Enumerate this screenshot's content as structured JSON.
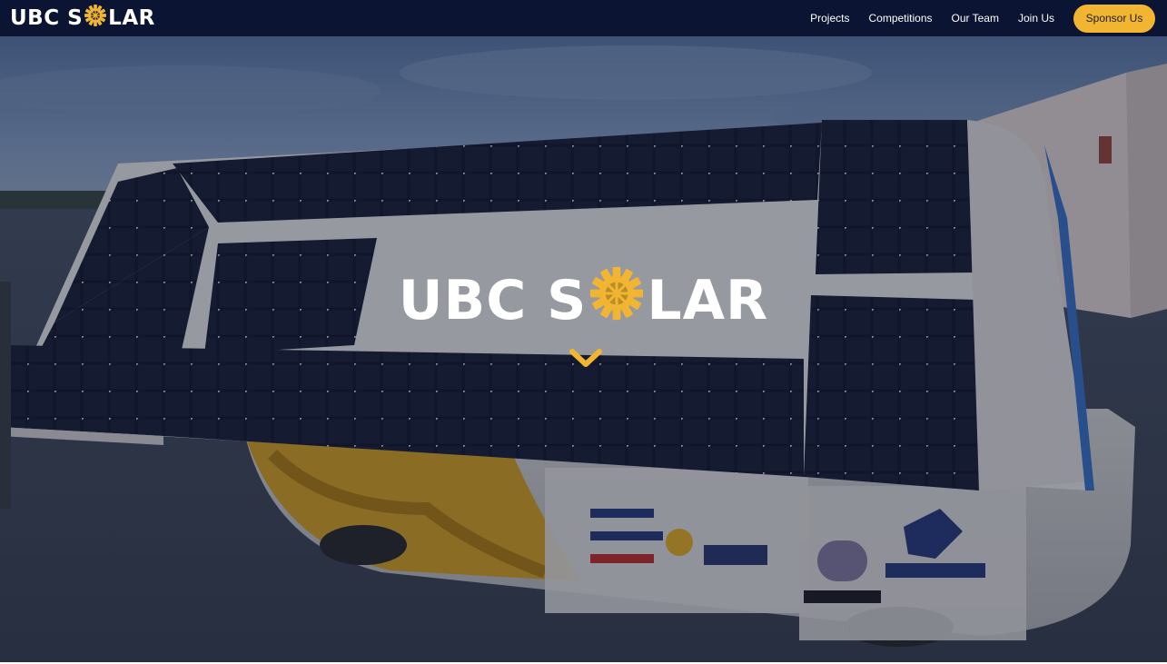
{
  "brand": {
    "logo_text_before": "UBC S",
    "logo_text_after": "LAR",
    "accent_color": "#f2b531",
    "navbar_color": "#0b1533"
  },
  "nav": {
    "items": [
      {
        "label": "Projects"
      },
      {
        "label": "Competitions"
      },
      {
        "label": "Our Team"
      },
      {
        "label": "Join Us"
      }
    ],
    "cta_label": "Sponsor Us"
  },
  "hero": {
    "title_before": "UBC S",
    "title_after": "LAR",
    "scroll_icon": "chevron-down-icon",
    "background": "solar-car-photo"
  }
}
